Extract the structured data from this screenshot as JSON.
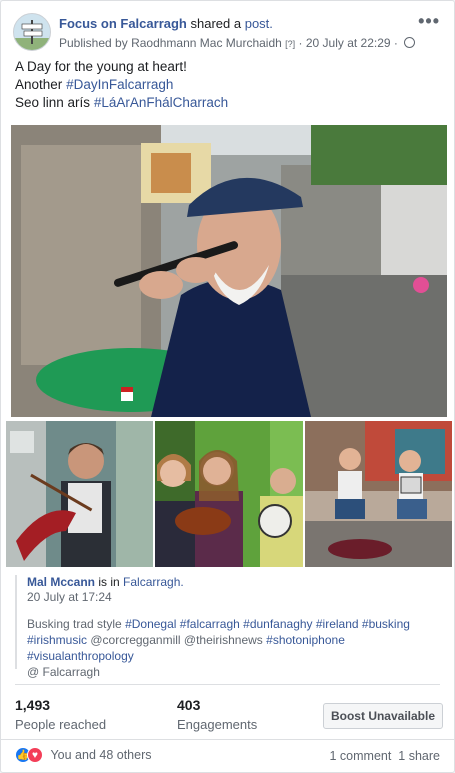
{
  "header": {
    "page_name": "Focus on Falcarragh",
    "shared_text": "shared a",
    "post_link": "post.",
    "published_prefix": "Published by",
    "publisher": "Raodhmann Mac Murchaidh",
    "publisher_badge": "[?]",
    "timestamp": "20 July at 22:29",
    "more_icon": "more-icon",
    "avatar_icon": "page-avatar"
  },
  "post": {
    "line1": "A Day for the young at heart!",
    "line2_prefix": "Another",
    "line2_tag": "#DayInFalcarragh",
    "line3_prefix": "Seo linn arís",
    "line3_tag": "#LáArAnFhálCharrach"
  },
  "original_post": {
    "author": "Mal Mccann",
    "is_in": "is in",
    "location": "Falcarragh.",
    "date": "20 July at 17:24",
    "caption_prefix": "Busking trad style",
    "tags_line1": "#Donegal #falcarragh #dunfanaghy #ireland #busking",
    "tags_line2a": "#irishmusic",
    "mention1": "@corcregganmill @theirishnews",
    "tags_line2b": "#shotoniphone #visualanthropology",
    "location_mention": "@ Falcarragh"
  },
  "stats": {
    "reached_value": "1,493",
    "reached_label": "People reached",
    "engagements_value": "403",
    "engagements_label": "Engagements",
    "boost_label": "Boost Unavailable"
  },
  "footer": {
    "reactions_text": "You and 48 others",
    "comments": "1 comment",
    "shares": "1 share"
  },
  "colors": {
    "link": "#385898",
    "like": "#1877f2",
    "love": "#f33e58"
  }
}
